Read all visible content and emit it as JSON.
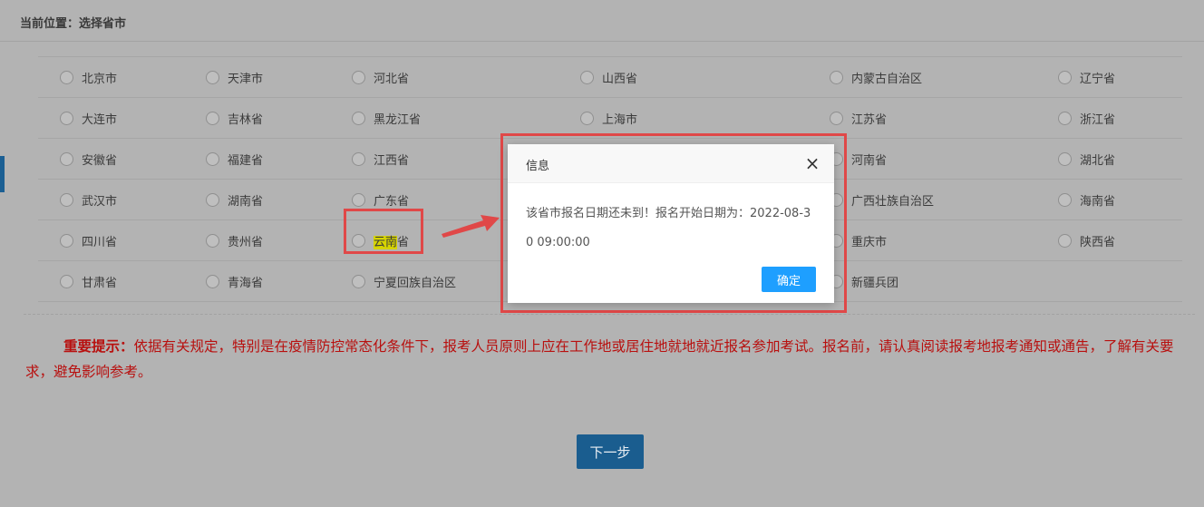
{
  "breadcrumb": {
    "label": "当前位置：",
    "page": "选择省市"
  },
  "options": [
    [
      "北京市",
      "天津市",
      "河北省",
      "山西省",
      "内蒙古自治区",
      "辽宁省"
    ],
    [
      "大连市",
      "吉林省",
      "黑龙江省",
      "上海市",
      "江苏省",
      "浙江省"
    ],
    [
      "安徽省",
      "福建省",
      "江西省",
      "",
      "河南省",
      "湖北省"
    ],
    [
      "武汉市",
      "湖南省",
      "广东省",
      "",
      "广西壮族自治区",
      "海南省"
    ],
    [
      "四川省",
      "贵州省",
      "",
      "",
      "重庆市",
      "陕西省"
    ],
    [
      "甘肃省",
      "青海省",
      "宁夏回族自治区",
      "",
      "新疆兵团",
      ""
    ]
  ],
  "highlight": {
    "marked": "云南",
    "rest": "省"
  },
  "notice": {
    "title": "重要提示：",
    "text": "依据有关规定，特别是在疫情防控常态化条件下，报考人员原则上应在工作地或居住地就地就近报名参加考试。报名前，请认真阅读报考地报考通知或通告，了解有关要求，避免影响参考。"
  },
  "next_button": "下一步",
  "dialog": {
    "title": "信息",
    "message": "该省市报名日期还未到！报名开始日期为：2022-08-30 09:00:00",
    "ok": "确定",
    "close": "×"
  },
  "colors": {
    "accent": "#1e9fff",
    "annotation": "#e04848",
    "notice": "#b8100f"
  }
}
